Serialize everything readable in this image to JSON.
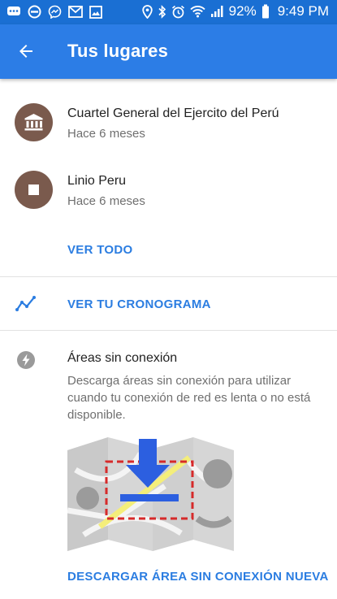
{
  "status_bar": {
    "battery": "92%",
    "time": "9:49 PM",
    "left_icons": [
      "chat-icon",
      "do-not-disturb-icon",
      "messenger-icon",
      "gmail-icon",
      "image-icon"
    ],
    "right_icons": [
      "location-icon",
      "bluetooth-icon",
      "alarm-icon",
      "wifi-icon",
      "signal-icon",
      "battery-icon"
    ]
  },
  "appbar": {
    "title": "Tus lugares",
    "back_icon": "arrow-back-icon",
    "color": "#2c7de6"
  },
  "places": [
    {
      "name": "Cuartel General del Ejercito del Perú",
      "time": "Hace 6 meses",
      "icon": "bank-icon"
    },
    {
      "name": "Linio Peru",
      "time": "Hace 6 meses",
      "icon": "stop-icon"
    }
  ],
  "links": {
    "see_all": "VER TODO",
    "timeline": "VER TU CRONOGRAMA",
    "download": "DESCARGAR ÁREA SIN CONEXIÓN NUEVA"
  },
  "offline": {
    "title": "Áreas sin conexión",
    "description": "Descarga áreas sin conexión para utilizar cuando tu conexión de red es lenta o no está disponible.",
    "icon": "bolt-icon"
  },
  "colors": {
    "accent": "#2b7de1",
    "avatar": "#7a5a4d",
    "status_bar": "#1a6fd3"
  }
}
